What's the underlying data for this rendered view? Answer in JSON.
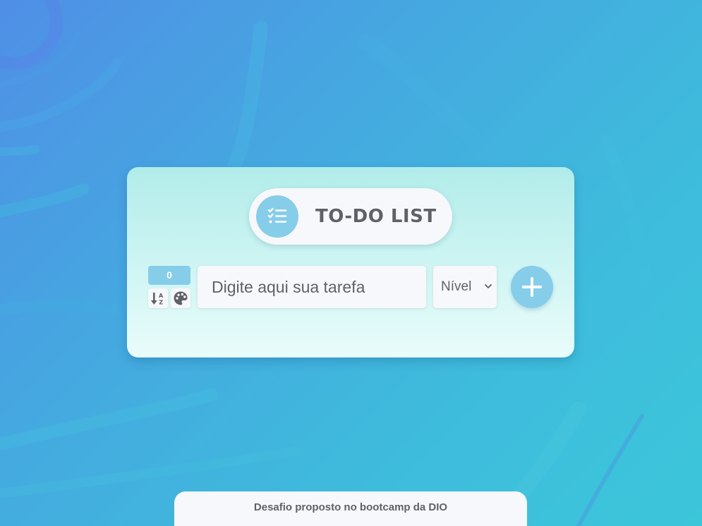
{
  "app": {
    "title": "TO-DO LIST",
    "title_icon": "checklist-icon"
  },
  "toolbar": {
    "task_count": "0",
    "sort_icon": "sort-alpha-down-icon",
    "theme_icon": "palette-icon",
    "task_input_placeholder": "Digite aqui sua tarefa",
    "task_input_value": "",
    "level_select_value": "Nível",
    "add_icon": "plus-icon"
  },
  "footer": {
    "text": "Desafio proposto no bootcamp da DIO"
  },
  "colors": {
    "accent": "#86cdea",
    "text": "#5e6266",
    "surface": "#f7f8fb"
  }
}
